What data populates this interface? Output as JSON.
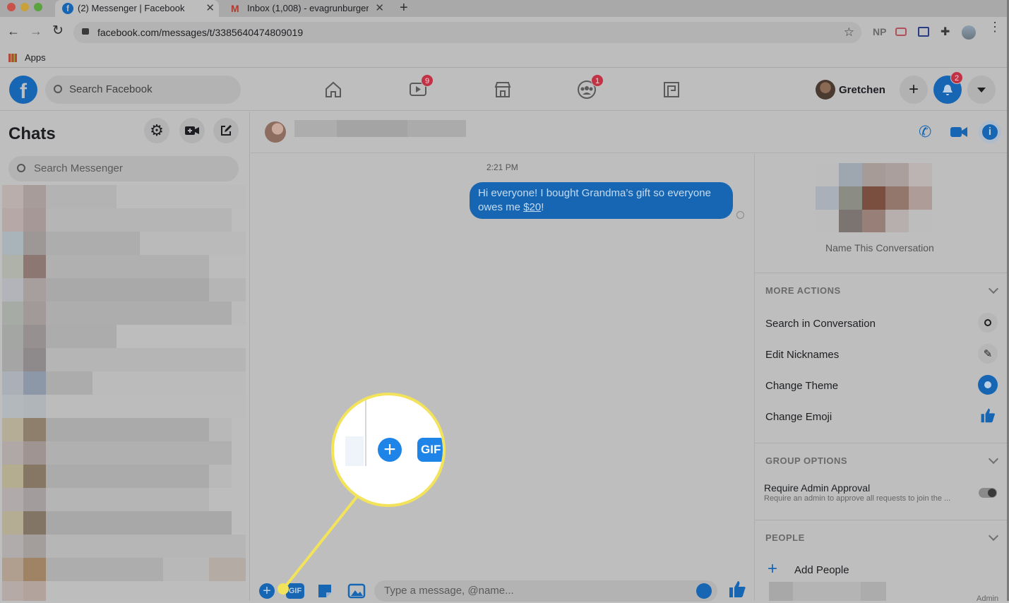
{
  "browser": {
    "tabs": [
      {
        "label": "(2) Messenger | Facebook",
        "icon": "facebook-icon"
      },
      {
        "label": "Inbox (1,008) - evagrunburger",
        "icon": "gmail-icon"
      }
    ],
    "new_tab": "+",
    "url": "facebook.com/messages/t/3385640474809019",
    "extensions": [
      "NP"
    ],
    "bookmarks_apps": "Apps"
  },
  "fb_header": {
    "search_placeholder": "Search Facebook",
    "nav": [
      {
        "name": "home-icon",
        "badge": ""
      },
      {
        "name": "watch-icon",
        "badge": "9"
      },
      {
        "name": "marketplace-icon",
        "badge": ""
      },
      {
        "name": "groups-icon",
        "badge": "1"
      },
      {
        "name": "gaming-icon",
        "badge": ""
      }
    ],
    "user_name": "Gretchen",
    "notifications_badge": "2"
  },
  "chats": {
    "title": "Chats",
    "search_placeholder": "Search Messenger"
  },
  "conversation": {
    "timestamp": "2:21 PM",
    "message_text": "Hi everyone! I bought Grandma’s gift so everyone owes me ",
    "message_amount": "$20",
    "message_end": "!",
    "composer_placeholder": "Type a message, @name...",
    "callout_gif": "GIF"
  },
  "details": {
    "name_this": "Name This Conversation",
    "more_actions": "MORE ACTIONS",
    "actions": [
      {
        "label": "Search in Conversation",
        "icon": "search-icon"
      },
      {
        "label": "Edit Nicknames",
        "icon": "pencil-icon"
      },
      {
        "label": "Change Theme",
        "icon": "theme-icon"
      },
      {
        "label": "Change Emoji",
        "icon": "thumbs-up-icon"
      }
    ],
    "group_options": "GROUP OPTIONS",
    "require_admin": "Require Admin Approval",
    "require_admin_sub": "Require an admin to approve all requests to join the ...",
    "people": "PEOPLE",
    "add_people": "Add People",
    "admin_label": "Admin"
  },
  "colors": {
    "accent": "#1766b4",
    "callout": "#f2e35a",
    "badge": "#c23245"
  }
}
